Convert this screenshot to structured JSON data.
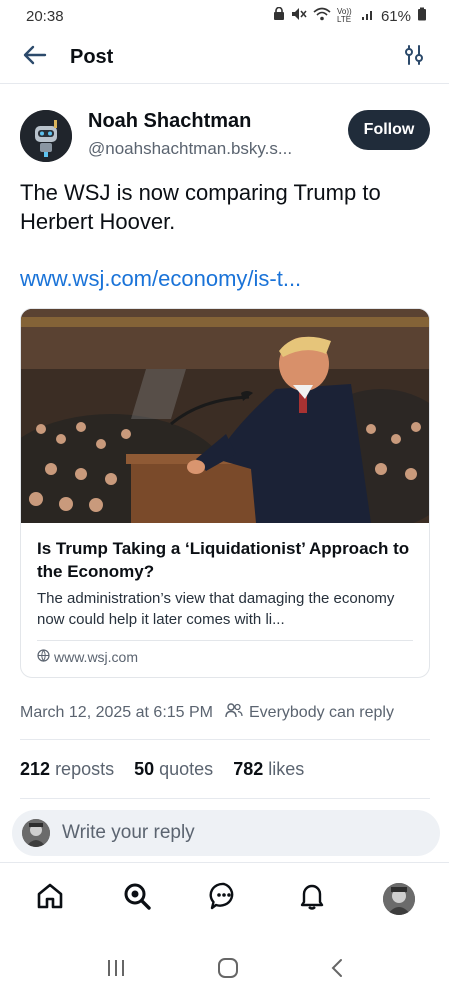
{
  "status": {
    "time": "20:38",
    "battery": "61%",
    "network_label": "Vo)) LTE"
  },
  "header": {
    "title": "Post"
  },
  "post": {
    "author_name": "Noah Shachtman",
    "author_handle": "@noahshachtman.bsky.s...",
    "follow_label": "Follow",
    "text": "The WSJ is now comparing Trump to Herbert Hoover.",
    "link_text": "www.wsj.com/economy/is-t...",
    "card": {
      "title": "Is Trump Taking a ‘Liquidationist’ Approach to the Economy?",
      "description": "The administration’s view that damaging the economy now could help it later comes with li...",
      "domain": "www.wsj.com"
    },
    "timestamp": "March 12, 2025 at 6:15 PM",
    "reply_setting": "Everybody can reply",
    "stats": {
      "reposts_count": "212",
      "reposts_label": "reposts",
      "quotes_count": "50",
      "quotes_label": "quotes",
      "likes_count": "782",
      "likes_label": "likes"
    }
  },
  "reply": {
    "placeholder": "Write your reply"
  },
  "icons": {
    "back": "arrow-left-icon",
    "filter": "sliders-icon",
    "home": "home-icon",
    "search": "search-icon",
    "chat": "chat-icon",
    "notifications": "bell-icon",
    "globe": "globe-icon",
    "people": "people-icon"
  },
  "colors": {
    "accent": "#1a73d8",
    "follow_bg": "#202c3a",
    "muted": "#5b6470"
  }
}
